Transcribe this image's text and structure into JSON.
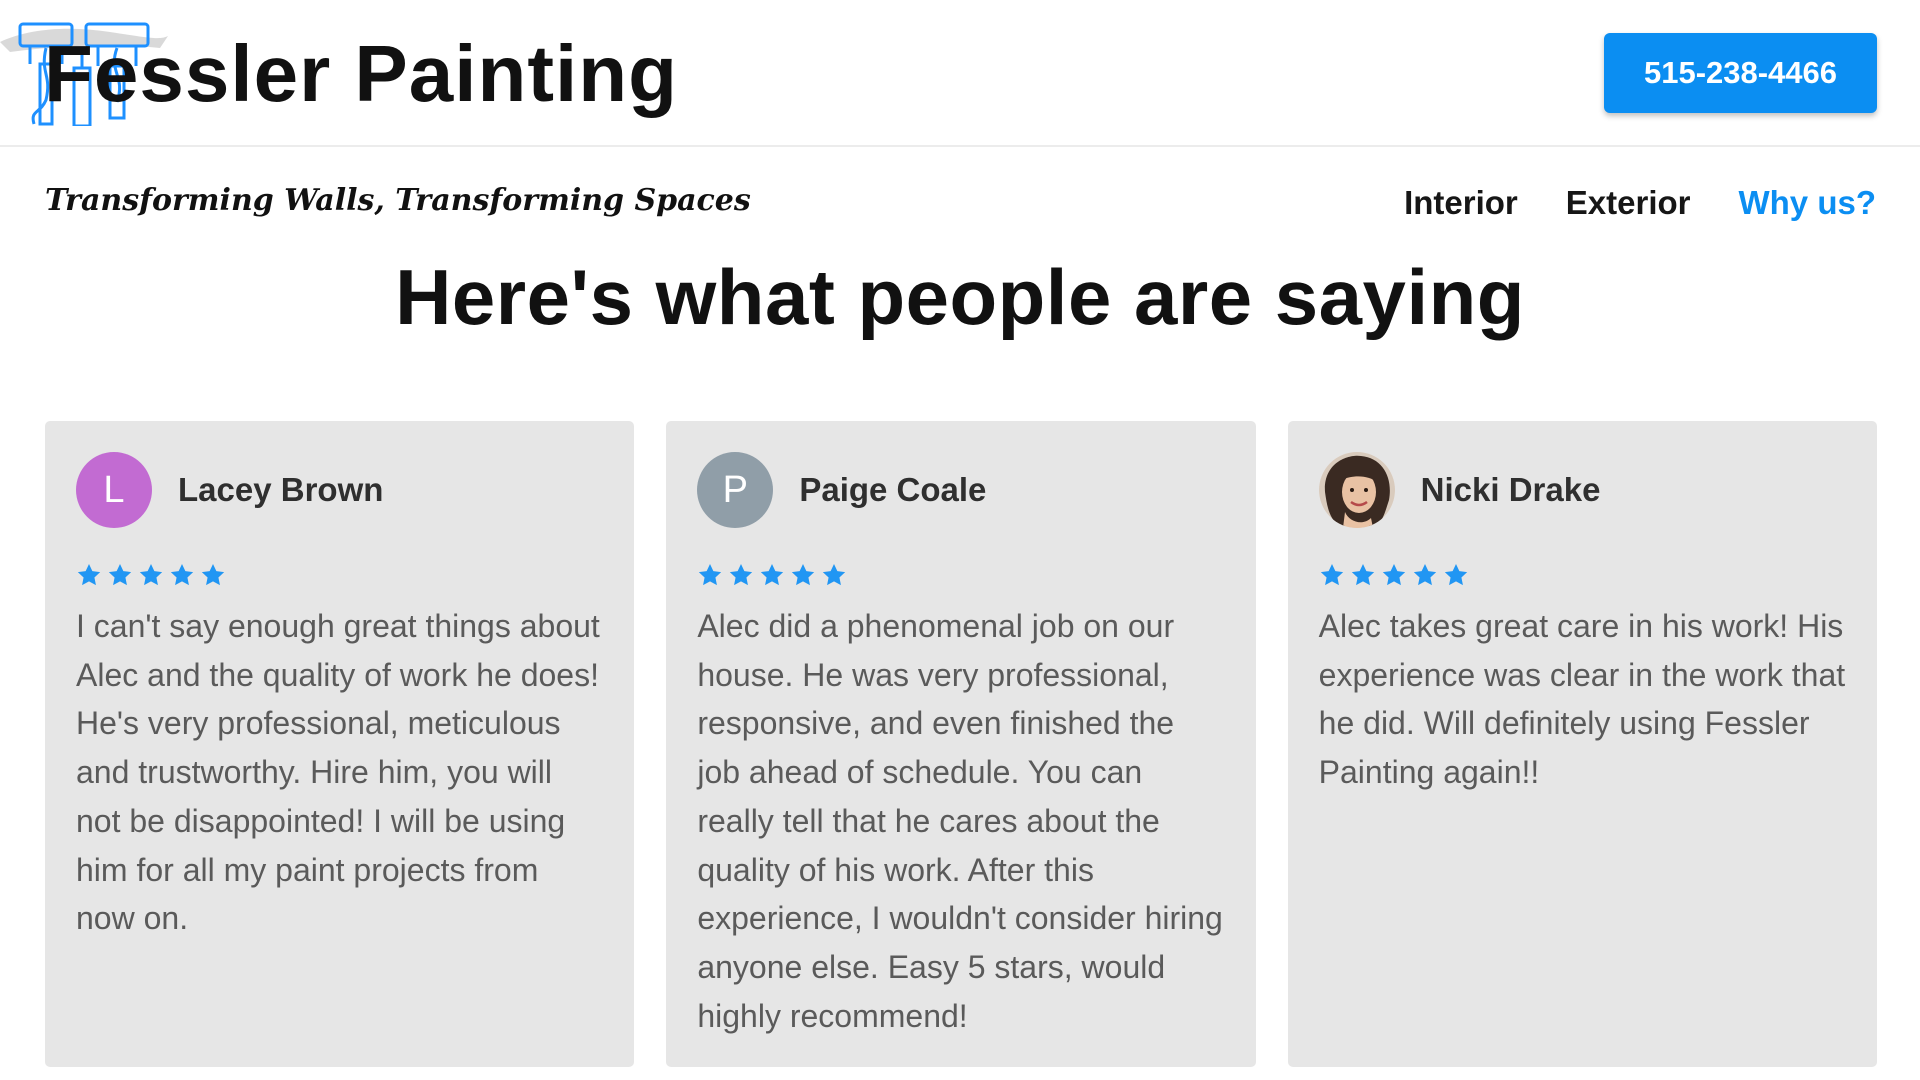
{
  "header": {
    "brand": "Fessler Painting",
    "phone": "515-238-4466",
    "logo_icon": "paintbrush-icon"
  },
  "subheader": {
    "tagline": "Transforming Walls, Transforming Spaces",
    "nav": [
      {
        "label": "Interior",
        "active": false
      },
      {
        "label": "Exterior",
        "active": false
      },
      {
        "label": "Why us?",
        "active": true
      }
    ]
  },
  "section": {
    "title": "Here's what people are saying"
  },
  "reviews": [
    {
      "initial": "L",
      "name": "Lacey Brown",
      "avatar_color": "#c26bd2",
      "rating": 5,
      "text": "I can't say enough great things about Alec and the quality of work he does! He's very professional, meticulous and trustworthy. Hire him, you will not be disappointed! I will be using him for all my paint projects from now on."
    },
    {
      "initial": "P",
      "name": "Paige Coale",
      "avatar_color": "#909ea8",
      "rating": 5,
      "text": "Alec did a phenomenal job on our house. He was very professional, responsive, and even finished the job ahead of schedule. You can really tell that he cares about the quality of his work. After this experience, I wouldn't consider hiring anyone else. Easy 5 stars, would highly recommend!"
    },
    {
      "initial": "",
      "name": "Nicki Drake",
      "avatar_color": "#6a4a3a",
      "rating": 5,
      "text": "Alec takes great care in his work! His experience was clear in the work that he did. Will definitely using Fessler Painting again!!"
    }
  ],
  "colors": {
    "accent": "#0b8ef2",
    "star": "#2196f3",
    "card_bg": "#e6e6e6"
  }
}
